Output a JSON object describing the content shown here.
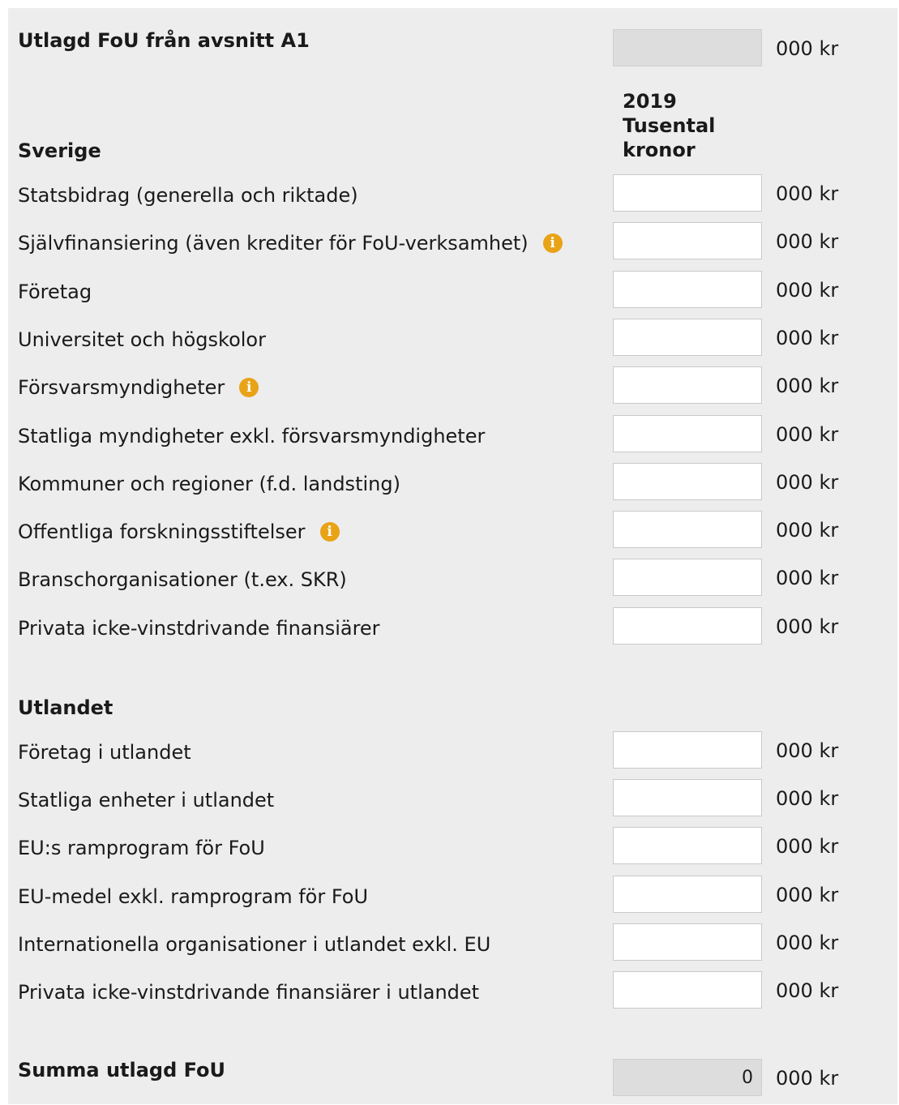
{
  "top": {
    "label": "Utlagd FoU från avsnitt A1",
    "value": "",
    "unit": "000 kr"
  },
  "column_header": {
    "line1": "2019",
    "line2": "Tusental",
    "line3": "kronor"
  },
  "sverige": {
    "heading": "Sverige",
    "rows": [
      {
        "label": "Statsbidrag (generella och riktade)",
        "value": "",
        "unit": "000 kr",
        "info": false
      },
      {
        "label": "Självfinansiering (även krediter för FoU-verksamhet)",
        "value": "",
        "unit": "000 kr",
        "info": true
      },
      {
        "label": "Företag",
        "value": "",
        "unit": "000 kr",
        "info": false
      },
      {
        "label": "Universitet och högskolor",
        "value": "",
        "unit": "000 kr",
        "info": false
      },
      {
        "label": "Försvarsmyndigheter",
        "value": "",
        "unit": "000 kr",
        "info": true
      },
      {
        "label": "Statliga myndigheter exkl. försvarsmyndigheter",
        "value": "",
        "unit": "000 kr",
        "info": false
      },
      {
        "label": "Kommuner och regioner (f.d. landsting)",
        "value": "",
        "unit": "000 kr",
        "info": false
      },
      {
        "label": "Offentliga forskningsstiftelser",
        "value": "",
        "unit": "000 kr",
        "info": true
      },
      {
        "label": "Branschorganisationer (t.ex. SKR)",
        "value": "",
        "unit": "000 kr",
        "info": false
      },
      {
        "label": "Privata icke-vinstdrivande finansiärer",
        "value": "",
        "unit": "000 kr",
        "info": false
      }
    ]
  },
  "utlandet": {
    "heading": "Utlandet",
    "rows": [
      {
        "label": "Företag i utlandet",
        "value": "",
        "unit": "000 kr"
      },
      {
        "label": "Statliga enheter i utlandet",
        "value": "",
        "unit": "000 kr"
      },
      {
        "label": "EU:s ramprogram för FoU",
        "value": "",
        "unit": "000 kr"
      },
      {
        "label": "EU-medel exkl. ramprogram för FoU",
        "value": "",
        "unit": "000 kr"
      },
      {
        "label": "Internationella organisationer i utlandet exkl. EU",
        "value": "",
        "unit": "000 kr"
      },
      {
        "label": "Privata icke-vinstdrivande finansiärer i utlandet",
        "value": "",
        "unit": "000 kr"
      }
    ]
  },
  "summa": {
    "label": "Summa utlagd FoU",
    "value": "0",
    "unit": "000 kr"
  },
  "icons": {
    "info": "info-icon",
    "info_glyph": "i"
  },
  "colors": {
    "info": "#e8a317",
    "panel": "#ededed",
    "readonly": "#dddddd"
  }
}
